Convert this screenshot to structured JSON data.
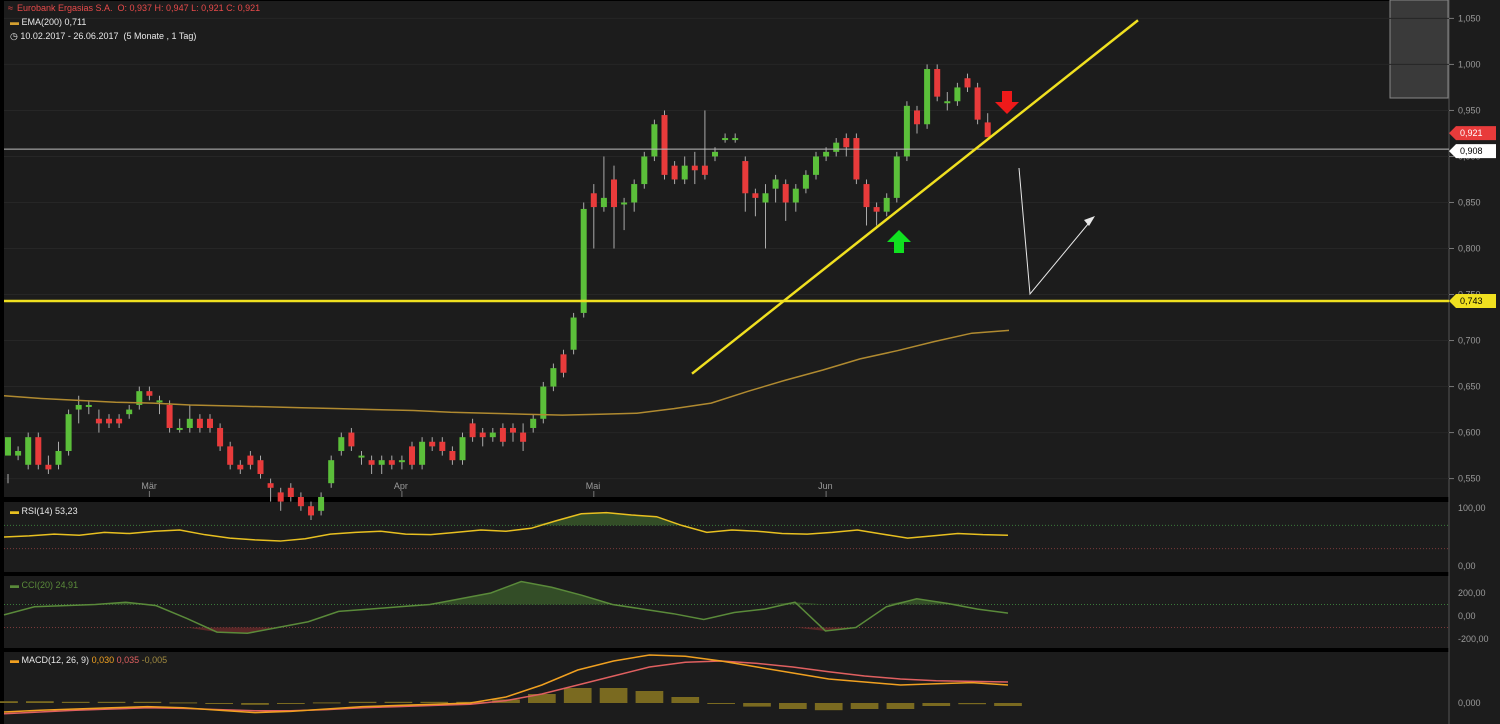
{
  "header": {
    "instrument": "Eurobank Ergasias S.A.",
    "ohlc": "O: 0,937  H: 0,947  L: 0,921  C: 0,921",
    "ema_label": "EMA(200)",
    "ema_value": "0,711",
    "period": "10.02.2017 - 26.06.2017",
    "period_note": "(5 Monate , 1 Tag)"
  },
  "colors": {
    "background": "#1c1c1c",
    "up": "#5bbf3a",
    "down": "#e83b3b",
    "trendline": "#f0e020",
    "ema": "#b08a30",
    "rsi": "#e8c020",
    "cci": "#5a8a3a",
    "macd_line": "#f0a020",
    "signal_line": "#e06060",
    "histogram": "#7a6a20"
  },
  "price_tags": {
    "last": "0,921",
    "hline": "0,908",
    "support": "0,743"
  },
  "months": [
    "Mär",
    "Apr",
    "Mai",
    "Jun"
  ],
  "panels": {
    "rsi": {
      "label": "RSI(14)",
      "value": "53,23",
      "ticks": [
        "100,00",
        "0,00"
      ]
    },
    "cci": {
      "label": "CCI(20)",
      "value": "24,91",
      "ticks": [
        "200,00",
        "0,00",
        "-200,00"
      ]
    },
    "macd": {
      "label": "MACD(12, 26, 9)",
      "value1": "0,030",
      "value2": "0,035",
      "value3": "-0,005",
      "ticks": [
        "0,000"
      ]
    }
  },
  "chart_data": {
    "type": "candlestick",
    "title": "Eurobank Ergasias S.A.",
    "ylim": [
      0.53,
      1.07
    ],
    "y_ticks": [
      1.05,
      1.0,
      0.95,
      0.9,
      0.85,
      0.8,
      0.75,
      0.7,
      0.65,
      0.6,
      0.55
    ],
    "y_tick_labels": [
      "1,050",
      "1,000",
      "0,950",
      "0,900",
      "0,850",
      "0,800",
      "0,750",
      "0,700",
      "0,650",
      "0,600",
      "0,550"
    ],
    "candles": [
      [
        0.575,
        0.595,
        0.555,
        0.545
      ],
      [
        0.575,
        0.58,
        0.585,
        0.57
      ],
      [
        0.565,
        0.595,
        0.6,
        0.56
      ],
      [
        0.595,
        0.565,
        0.6,
        0.56
      ],
      [
        0.565,
        0.56,
        0.575,
        0.555
      ],
      [
        0.565,
        0.58,
        0.59,
        0.56
      ],
      [
        0.58,
        0.62,
        0.625,
        0.575
      ],
      [
        0.625,
        0.63,
        0.64,
        0.61
      ],
      [
        0.63,
        0.63,
        0.635,
        0.62
      ],
      [
        0.615,
        0.61,
        0.625,
        0.6
      ],
      [
        0.615,
        0.61,
        0.62,
        0.605
      ],
      [
        0.615,
        0.61,
        0.62,
        0.605
      ],
      [
        0.62,
        0.625,
        0.63,
        0.615
      ],
      [
        0.63,
        0.645,
        0.65,
        0.625
      ],
      [
        0.645,
        0.64,
        0.65,
        0.635
      ],
      [
        0.635,
        0.635,
        0.64,
        0.62
      ],
      [
        0.63,
        0.605,
        0.635,
        0.6
      ],
      [
        0.605,
        0.605,
        0.615,
        0.6
      ],
      [
        0.605,
        0.615,
        0.63,
        0.6
      ],
      [
        0.615,
        0.605,
        0.62,
        0.6
      ],
      [
        0.615,
        0.605,
        0.62,
        0.6
      ],
      [
        0.605,
        0.585,
        0.61,
        0.58
      ],
      [
        0.585,
        0.565,
        0.59,
        0.56
      ],
      [
        0.565,
        0.56,
        0.57,
        0.555
      ],
      [
        0.575,
        0.565,
        0.58,
        0.56
      ],
      [
        0.57,
        0.555,
        0.575,
        0.55
      ],
      [
        0.545,
        0.54,
        0.55,
        0.525
      ],
      [
        0.535,
        0.525,
        0.54,
        0.515
      ],
      [
        0.54,
        0.53,
        0.545,
        0.525
      ],
      [
        0.53,
        0.52,
        0.535,
        0.515
      ],
      [
        0.52,
        0.51,
        0.525,
        0.505
      ],
      [
        0.515,
        0.53,
        0.535,
        0.51
      ],
      [
        0.545,
        0.57,
        0.575,
        0.54
      ],
      [
        0.58,
        0.595,
        0.6,
        0.575
      ],
      [
        0.6,
        0.585,
        0.605,
        0.58
      ],
      [
        0.575,
        0.575,
        0.58,
        0.565
      ],
      [
        0.57,
        0.565,
        0.575,
        0.555
      ],
      [
        0.565,
        0.57,
        0.575,
        0.555
      ],
      [
        0.57,
        0.565,
        0.575,
        0.56
      ],
      [
        0.57,
        0.57,
        0.575,
        0.56
      ],
      [
        0.585,
        0.565,
        0.59,
        0.56
      ],
      [
        0.565,
        0.59,
        0.595,
        0.56
      ],
      [
        0.59,
        0.585,
        0.595,
        0.58
      ],
      [
        0.59,
        0.58,
        0.595,
        0.575
      ],
      [
        0.58,
        0.57,
        0.585,
        0.565
      ],
      [
        0.57,
        0.595,
        0.6,
        0.565
      ],
      [
        0.61,
        0.595,
        0.615,
        0.59
      ],
      [
        0.6,
        0.595,
        0.605,
        0.585
      ],
      [
        0.595,
        0.6,
        0.605,
        0.59
      ],
      [
        0.605,
        0.59,
        0.61,
        0.585
      ],
      [
        0.605,
        0.6,
        0.61,
        0.59
      ],
      [
        0.6,
        0.59,
        0.61,
        0.58
      ],
      [
        0.605,
        0.615,
        0.62,
        0.6
      ],
      [
        0.615,
        0.65,
        0.655,
        0.61
      ],
      [
        0.65,
        0.67,
        0.675,
        0.645
      ],
      [
        0.685,
        0.665,
        0.69,
        0.66
      ],
      [
        0.69,
        0.725,
        0.73,
        0.685
      ],
      [
        0.73,
        0.843,
        0.85,
        0.725
      ],
      [
        0.86,
        0.845,
        0.87,
        0.8
      ],
      [
        0.845,
        0.855,
        0.9,
        0.84
      ],
      [
        0.875,
        0.845,
        0.89,
        0.8
      ],
      [
        0.85,
        0.85,
        0.855,
        0.82
      ],
      [
        0.85,
        0.87,
        0.875,
        0.84
      ],
      [
        0.87,
        0.9,
        0.905,
        0.865
      ],
      [
        0.9,
        0.935,
        0.94,
        0.895
      ],
      [
        0.945,
        0.88,
        0.95,
        0.875
      ],
      [
        0.89,
        0.875,
        0.895,
        0.87
      ],
      [
        0.875,
        0.89,
        0.9,
        0.87
      ],
      [
        0.89,
        0.885,
        0.905,
        0.87
      ],
      [
        0.89,
        0.88,
        0.95,
        0.875
      ],
      [
        0.9,
        0.905,
        0.91,
        0.895
      ],
      [
        0.92,
        0.92,
        0.925,
        0.915
      ],
      [
        0.92,
        0.92,
        0.925,
        0.915
      ],
      [
        0.895,
        0.86,
        0.9,
        0.84
      ],
      [
        0.86,
        0.855,
        0.865,
        0.835
      ],
      [
        0.85,
        0.86,
        0.87,
        0.8
      ],
      [
        0.865,
        0.875,
        0.88,
        0.85
      ],
      [
        0.87,
        0.85,
        0.875,
        0.83
      ],
      [
        0.85,
        0.865,
        0.87,
        0.84
      ],
      [
        0.865,
        0.88,
        0.885,
        0.86
      ],
      [
        0.88,
        0.9,
        0.905,
        0.875
      ],
      [
        0.9,
        0.905,
        0.91,
        0.895
      ],
      [
        0.905,
        0.915,
        0.92,
        0.9
      ],
      [
        0.92,
        0.91,
        0.925,
        0.9
      ],
      [
        0.92,
        0.875,
        0.925,
        0.87
      ],
      [
        0.87,
        0.845,
        0.875,
        0.825
      ],
      [
        0.845,
        0.84,
        0.85,
        0.825
      ],
      [
        0.84,
        0.855,
        0.86,
        0.835
      ],
      [
        0.855,
        0.9,
        0.905,
        0.85
      ],
      [
        0.9,
        0.955,
        0.96,
        0.895
      ],
      [
        0.95,
        0.935,
        0.955,
        0.925
      ],
      [
        0.935,
        0.995,
        1.0,
        0.93
      ],
      [
        0.995,
        0.965,
        1.0,
        0.96
      ],
      [
        0.96,
        0.96,
        0.97,
        0.95
      ],
      [
        0.96,
        0.975,
        0.98,
        0.955
      ],
      [
        0.985,
        0.975,
        0.99,
        0.97
      ],
      [
        0.975,
        0.94,
        0.98,
        0.935
      ],
      [
        0.937,
        0.921,
        0.947,
        0.921
      ]
    ],
    "ema200": [
      0.64,
      0.637,
      0.635,
      0.633,
      0.632,
      0.63,
      0.629,
      0.628,
      0.627,
      0.626,
      0.625,
      0.624,
      0.622,
      0.621,
      0.62,
      0.619,
      0.62,
      0.621,
      0.626,
      0.632,
      0.645,
      0.657,
      0.668,
      0.68,
      0.689,
      0.699,
      0.708,
      0.711
    ],
    "support_level": 0.743,
    "hline_level": 0.908,
    "rsi": [
      50,
      52,
      55,
      53,
      58,
      56,
      60,
      62,
      54,
      48,
      45,
      43,
      47,
      55,
      58,
      60,
      55,
      54,
      58,
      62,
      60,
      65,
      78,
      90,
      92,
      88,
      85,
      70,
      58,
      62,
      60,
      56,
      55,
      58,
      62,
      55,
      48,
      52,
      56,
      54,
      53
    ],
    "cci": [
      10,
      80,
      90,
      100,
      120,
      90,
      -20,
      -140,
      -150,
      -100,
      -50,
      40,
      60,
      80,
      100,
      150,
      200,
      300,
      250,
      180,
      100,
      60,
      20,
      -30,
      30,
      60,
      120,
      -130,
      -100,
      80,
      150,
      110,
      60,
      25
    ],
    "macd": [
      -0.015,
      -0.012,
      -0.01,
      -0.008,
      -0.006,
      -0.008,
      -0.012,
      -0.016,
      -0.014,
      -0.01,
      -0.006,
      -0.004,
      -0.002,
      0.0,
      0.01,
      0.03,
      0.055,
      0.07,
      0.08,
      0.078,
      0.07,
      0.06,
      0.05,
      0.04,
      0.035,
      0.03,
      0.032,
      0.034,
      0.03
    ],
    "signal": [
      -0.018,
      -0.015,
      -0.012,
      -0.01,
      -0.008,
      -0.009,
      -0.011,
      -0.013,
      -0.013,
      -0.011,
      -0.008,
      -0.006,
      -0.004,
      -0.002,
      0.004,
      0.015,
      0.03,
      0.045,
      0.06,
      0.068,
      0.07,
      0.066,
      0.06,
      0.052,
      0.045,
      0.04,
      0.037,
      0.036,
      0.035
    ],
    "histogram": [
      0.003,
      0.003,
      0.002,
      0.002,
      0.002,
      0.001,
      -0.001,
      -0.003,
      -0.001,
      0.001,
      0.002,
      0.002,
      0.002,
      0.002,
      0.006,
      0.015,
      0.025,
      0.025,
      0.02,
      0.01,
      0.0,
      -0.006,
      -0.01,
      -0.012,
      -0.01,
      -0.01,
      -0.005,
      -0.002,
      -0.005
    ]
  }
}
